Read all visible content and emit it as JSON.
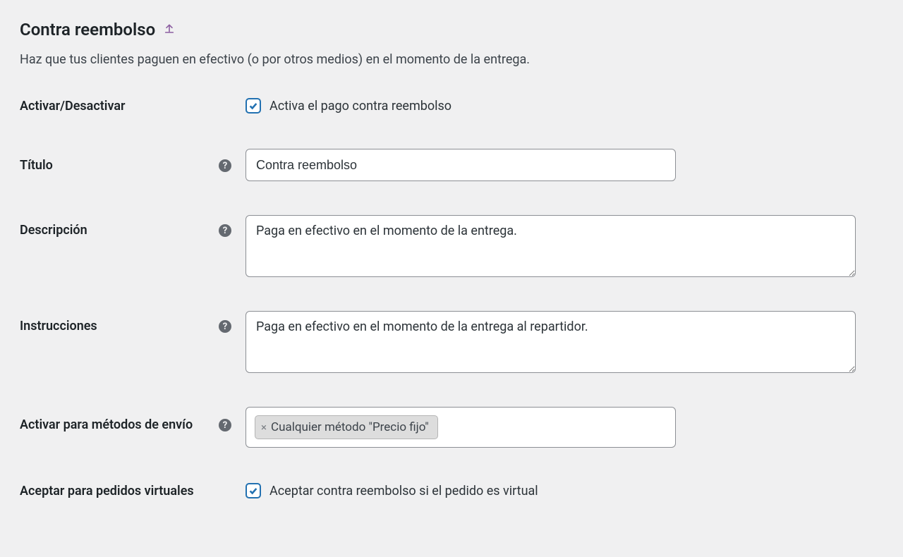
{
  "header": {
    "title": "Contra reembolso"
  },
  "intro": "Haz que tus clientes paguen en efectivo (o por otros medios) en el momento de la entrega.",
  "fields": {
    "enable": {
      "label": "Activar/Desactivar",
      "cb_label": "Activa el pago contra reembolso",
      "checked": true
    },
    "title": {
      "label": "Título",
      "value": "Contra reembolso"
    },
    "description": {
      "label": "Descripción",
      "value": "Paga en efectivo en el momento de la entrega."
    },
    "instructions": {
      "label": "Instrucciones",
      "value": "Paga en efectivo en el momento de la entrega al repartidor."
    },
    "shipping_methods": {
      "label": "Activar para métodos de envío",
      "tag": "Cualquier método \"Precio fijo\""
    },
    "virtual": {
      "label": "Aceptar para pedidos virtuales",
      "cb_label": "Aceptar contra reembolso si el pedido es virtual",
      "checked": true
    }
  }
}
